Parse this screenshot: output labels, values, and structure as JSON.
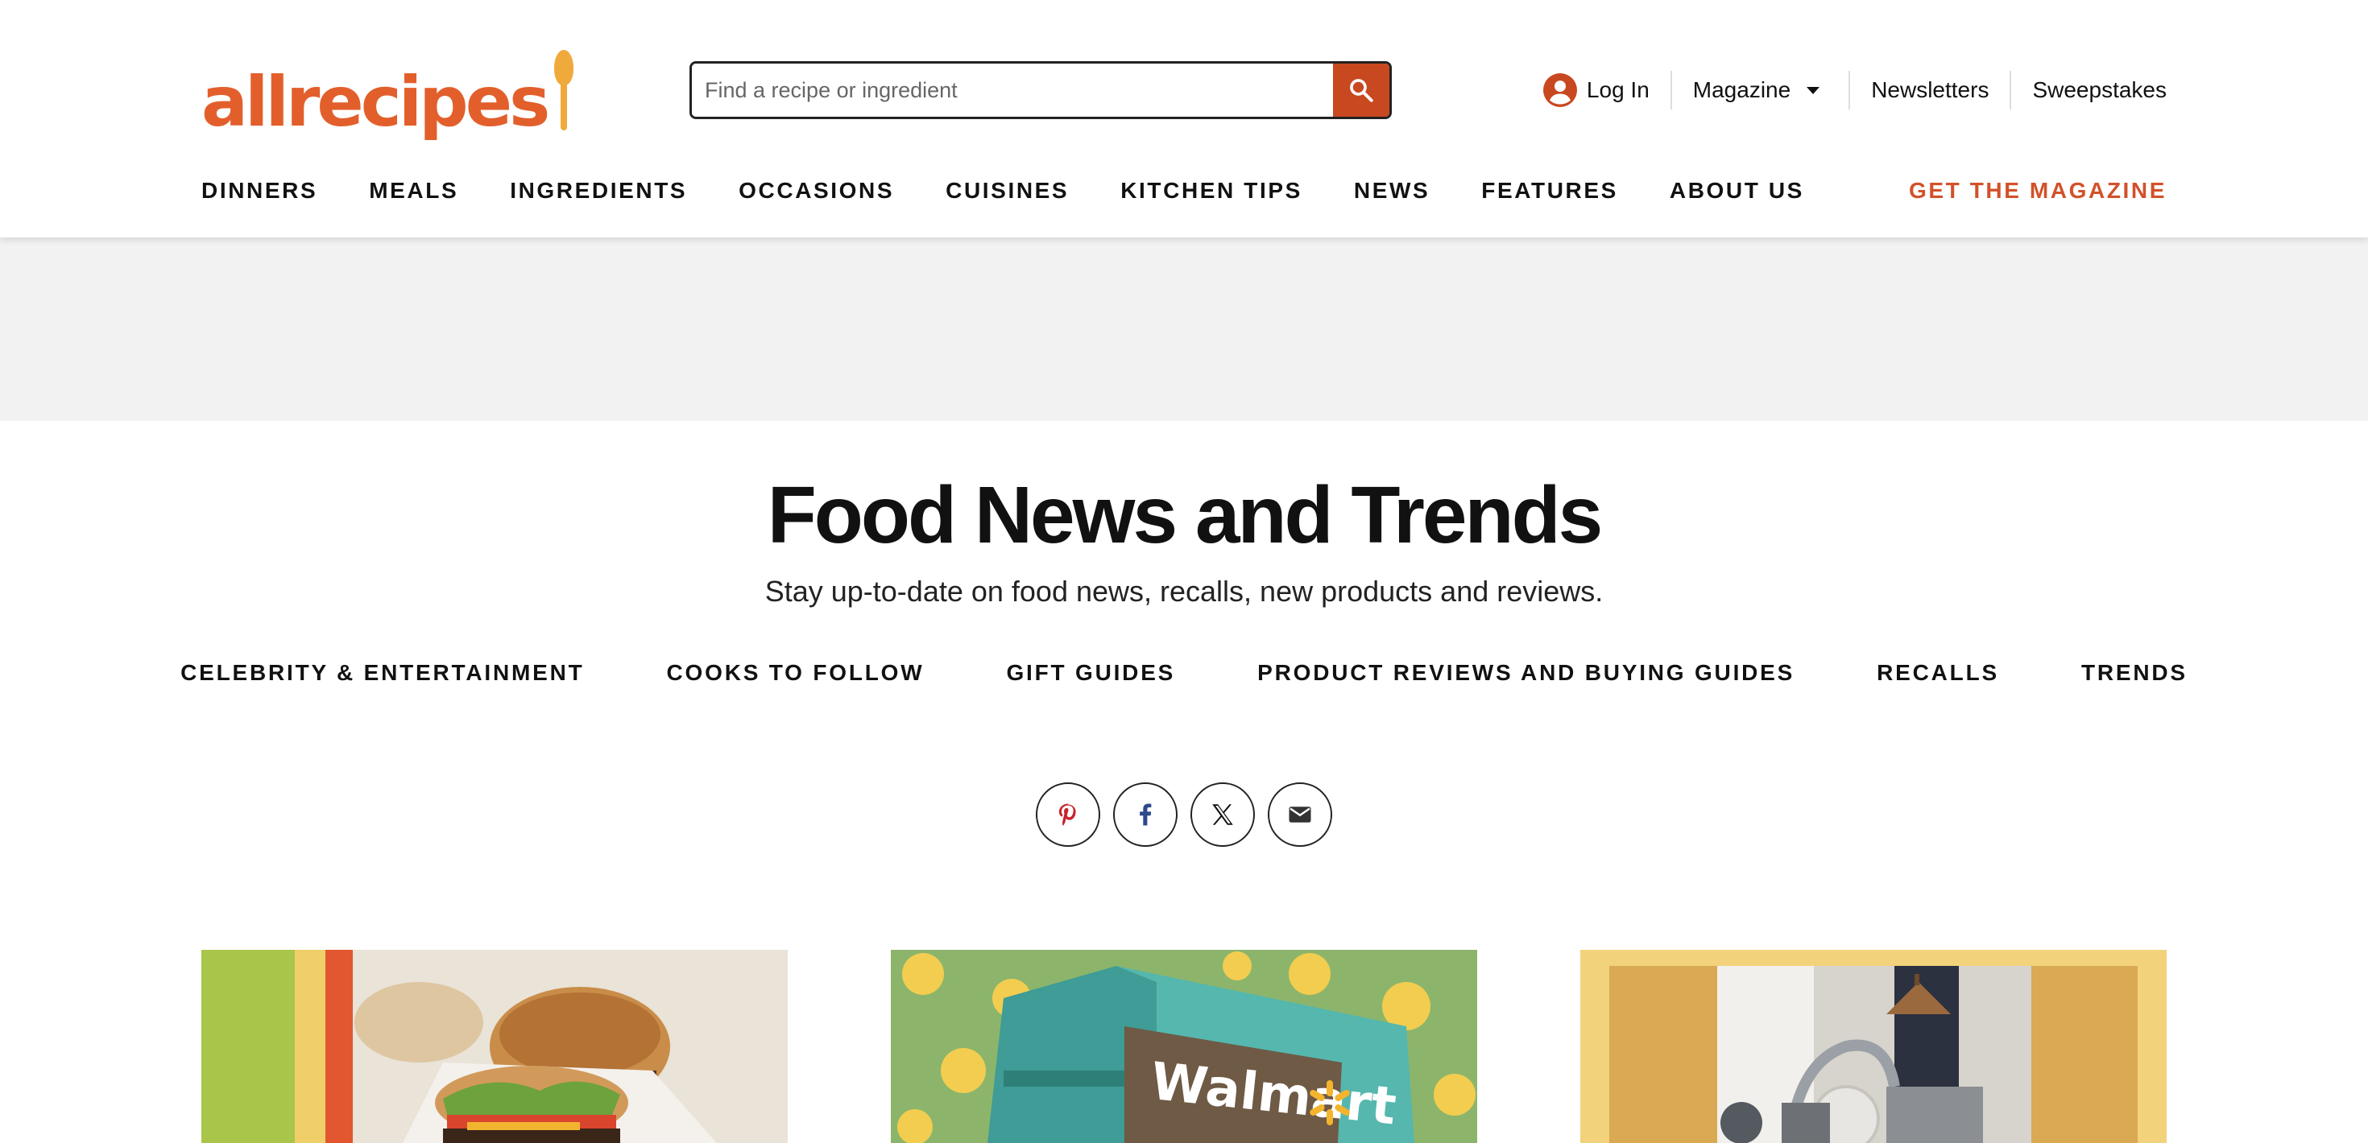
{
  "brand": {
    "logo_text": "allrecipes",
    "logo_color": "#e25f2c",
    "accent": "#f0a93b"
  },
  "search": {
    "placeholder": "Find a recipe or ingredient",
    "button_icon": "search-icon"
  },
  "utility_nav": {
    "login_label": "Log In",
    "login_icon": "user-account-icon",
    "magazine_label": "Magazine",
    "newsletters_label": "Newsletters",
    "sweepstakes_label": "Sweepstakes"
  },
  "main_nav": {
    "items": [
      "DINNERS",
      "MEALS",
      "INGREDIENTS",
      "OCCASIONS",
      "CUISINES",
      "KITCHEN TIPS",
      "NEWS",
      "FEATURES",
      "ABOUT US"
    ],
    "cta_label": "GET THE MAGAZINE",
    "cta_color": "#d2512a"
  },
  "hero": {
    "title": "Food News and Trends",
    "subtitle": "Stay up-to-date on food news, recalls, new products and reviews."
  },
  "sub_nav": {
    "items": [
      "CELEBRITY & ENTERTAINMENT",
      "COOKS TO FOLLOW",
      "GIFT GUIDES",
      "PRODUCT REVIEWS AND BUYING GUIDES",
      "RECALLS",
      "TRENDS"
    ]
  },
  "share": {
    "buttons": [
      "pinterest-icon",
      "facebook-icon",
      "x-icon",
      "email-icon"
    ],
    "pinterest_color": "#c8232c",
    "facebook_color": "#2d4a8a"
  },
  "cards": [
    {
      "image": "burger-photo"
    },
    {
      "image": "walmart-store-photo",
      "sign_text": "Walmart"
    },
    {
      "image": "kitchen-sink-photo"
    }
  ],
  "search_button_color": "#c8481f",
  "ad_band_color": "#f2f2f2"
}
